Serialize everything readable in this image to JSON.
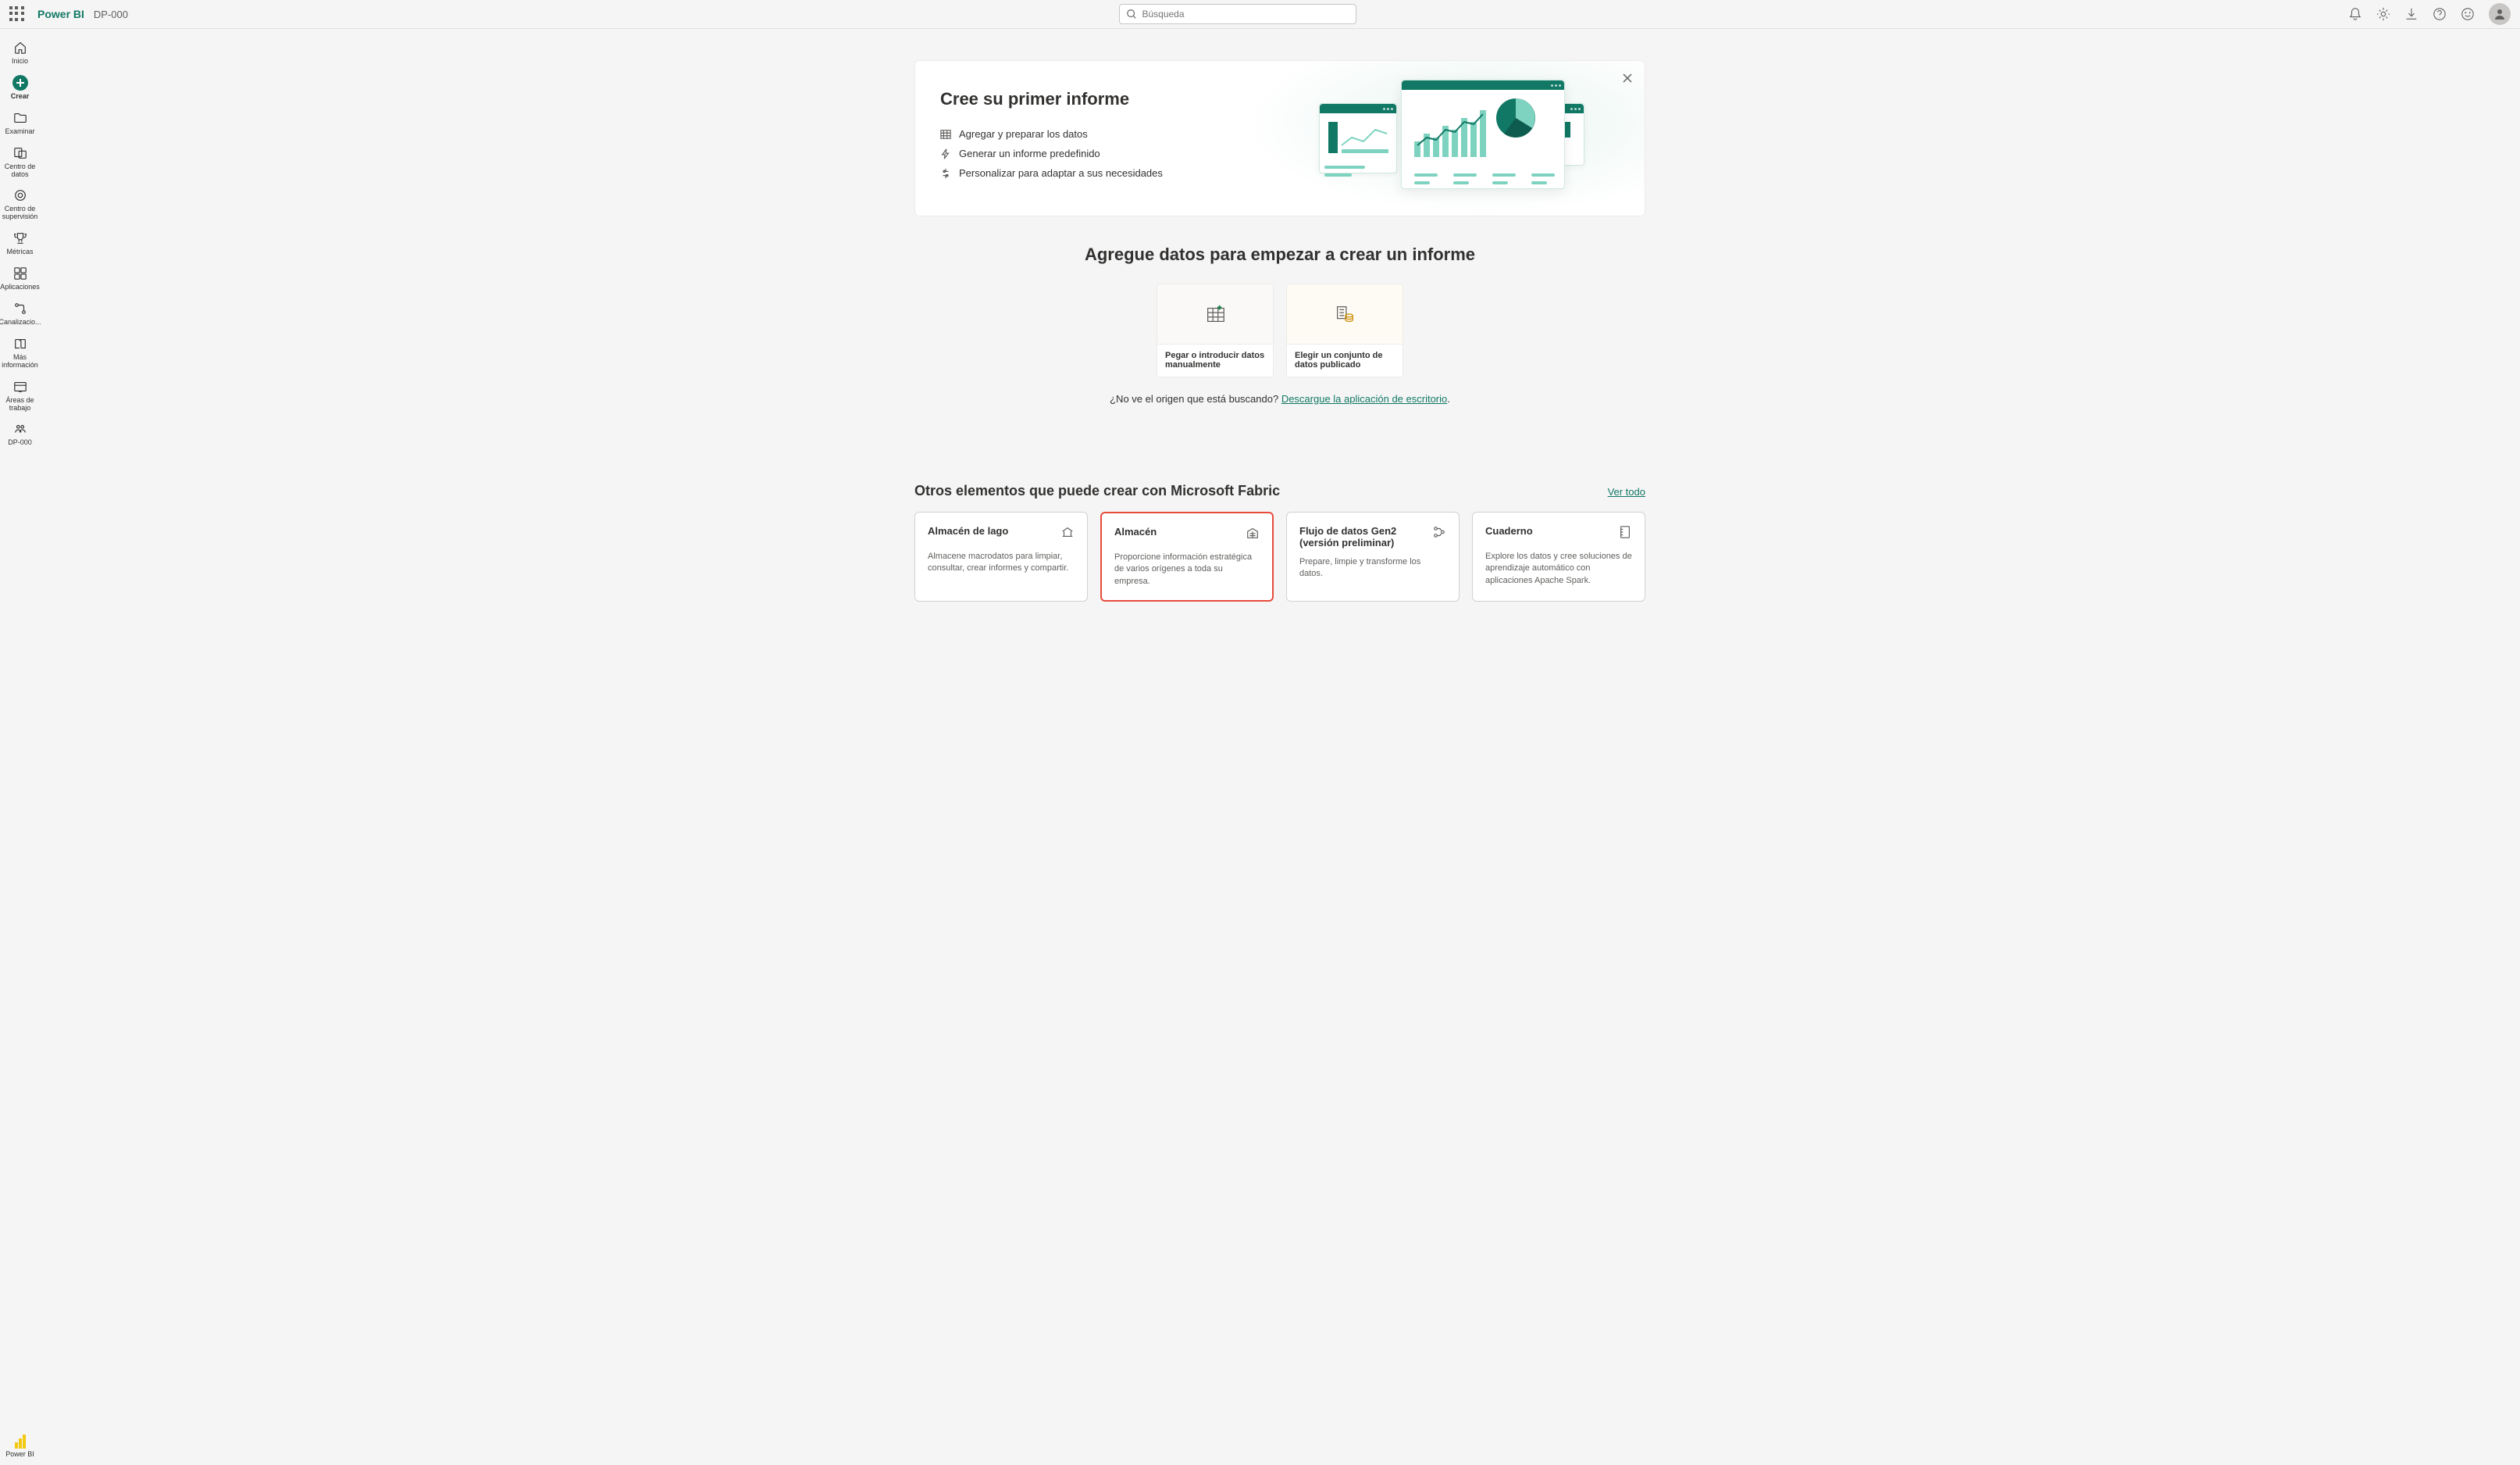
{
  "header": {
    "product": "Power BI",
    "workspace": "DP-000",
    "search_placeholder": "Búsqueda"
  },
  "sidebar": {
    "items": [
      {
        "label": "Inicio"
      },
      {
        "label": "Crear"
      },
      {
        "label": "Examinar"
      },
      {
        "label": "Centro de datos"
      },
      {
        "label": "Centro de supervisión"
      },
      {
        "label": "Métricas"
      },
      {
        "label": "Aplicaciones"
      },
      {
        "label": "Canalizacio..."
      },
      {
        "label": "Más información"
      },
      {
        "label": "Áreas de trabajo"
      },
      {
        "label": "DP-000"
      }
    ],
    "footer_label": "Power BI"
  },
  "hero": {
    "title": "Cree su primer informe",
    "steps": [
      "Agregar y preparar los datos",
      "Generar un informe predefinido",
      "Personalizar para adaptar a sus necesidades"
    ]
  },
  "add_data": {
    "title": "Agregue datos para empezar a crear un informe",
    "cards": [
      {
        "label": "Pegar o introducir datos manualmente"
      },
      {
        "label": "Elegir un conjunto de datos publicado"
      }
    ],
    "hint_prefix": "¿No ve el origen que está buscando? ",
    "hint_link": "Descargue la aplicación de escritorio",
    "hint_suffix": "."
  },
  "fabric": {
    "title": "Otros elementos que puede crear con Microsoft Fabric",
    "see_all": "Ver todo",
    "cards": [
      {
        "title": "Almacén de lago",
        "desc": "Almacene macrodatos para limpiar, consultar, crear informes y compartir."
      },
      {
        "title": "Almacén",
        "desc": "Proporcione información estratégica de varios orígenes a toda su empresa."
      },
      {
        "title": "Flujo de datos Gen2 (versión preliminar)",
        "desc": "Prepare, limpie y transforme los datos."
      },
      {
        "title": "Cuaderno",
        "desc": "Explore los datos y cree soluciones de aprendizaje automático con aplicaciones Apache Spark."
      }
    ]
  }
}
